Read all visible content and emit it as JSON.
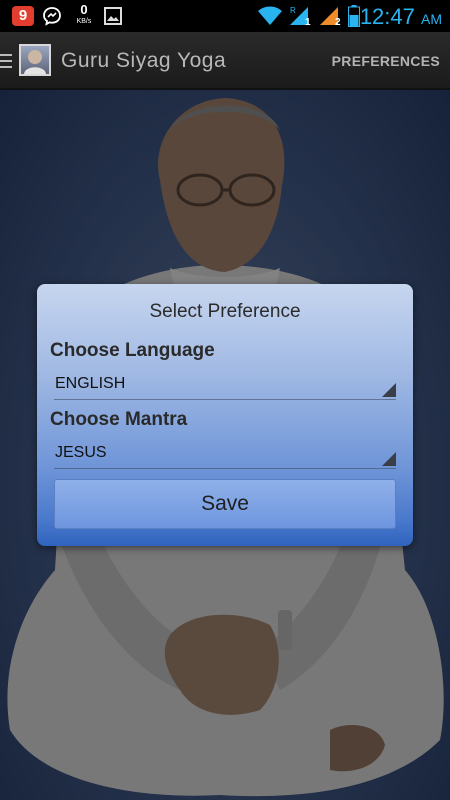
{
  "status_bar": {
    "notification_badge": "9",
    "network_speed_value": "0",
    "network_speed_unit": "KB/s",
    "time": "12:47",
    "ampm": "AM"
  },
  "action_bar": {
    "title": "Guru Siyag Yoga",
    "preferences_label": "PREFERENCES"
  },
  "dialog": {
    "title": "Select Preference",
    "language_label": "Choose Language",
    "language_value": "ENGLISH",
    "mantra_label": "Choose Mantra",
    "mantra_value": "JESUS",
    "save_label": "Save"
  },
  "colors": {
    "time_accent": "#29b4f0",
    "dialog_top": "#c7d6ef",
    "dialog_bottom": "#2f63be",
    "background": "#3a4e74"
  }
}
